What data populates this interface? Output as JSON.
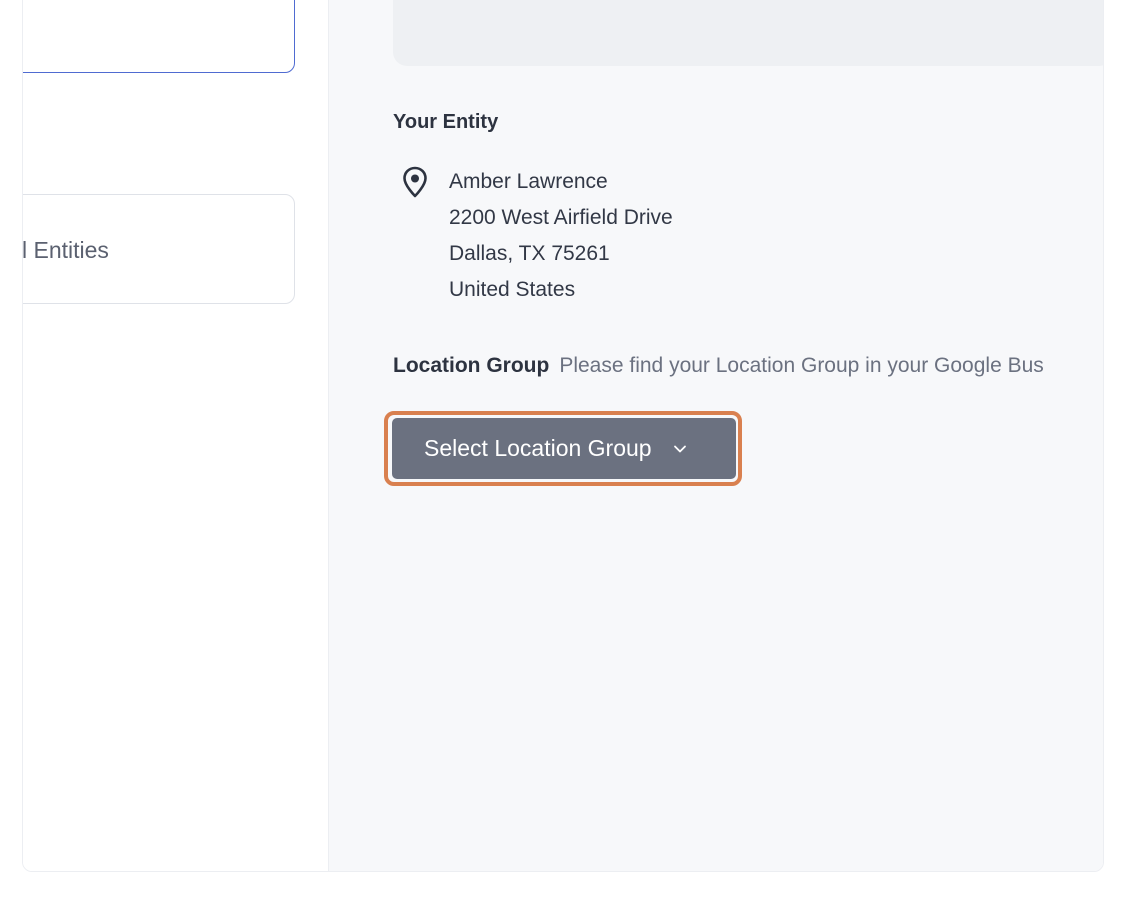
{
  "left": {
    "card_label": "l Entities"
  },
  "entity": {
    "title": "Your Entity",
    "name": "Amber Lawrence",
    "street": "2200 West Airfield Drive",
    "city_line": "Dallas, TX 75261",
    "country": "United States"
  },
  "location_group": {
    "label": "Location Group",
    "help": "Please find your Location Group in your Google Bus",
    "button_label": "Select Location Group"
  },
  "icons": {
    "pin": "map-pin-icon",
    "chevron": "chevron-down-icon"
  },
  "colors": {
    "highlight": "#d9804f",
    "button": "#6b7180",
    "selected_border": "#4f6bd1"
  }
}
